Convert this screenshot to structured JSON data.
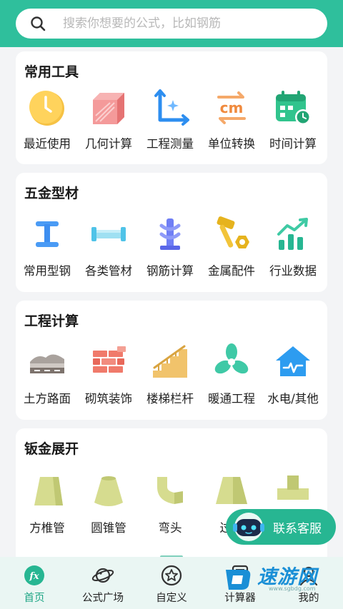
{
  "search": {
    "placeholder": "搜索你想要的公式，比如钢筋"
  },
  "sections": [
    {
      "title": "常用工具",
      "items": [
        {
          "label": "最近使用",
          "icon": "clock-icon"
        },
        {
          "label": "几何计算",
          "icon": "cube-icon"
        },
        {
          "label": "工程测量",
          "icon": "axis-icon"
        },
        {
          "label": "单位转换",
          "icon": "cm-convert-icon"
        },
        {
          "label": "时间计算",
          "icon": "calendar-clock-icon"
        }
      ]
    },
    {
      "title": "五金型材",
      "items": [
        {
          "label": "常用型钢",
          "icon": "i-beam-icon"
        },
        {
          "label": "各类管材",
          "icon": "pipe-icon"
        },
        {
          "label": "钢筋计算",
          "icon": "rebar-icon"
        },
        {
          "label": "金属配件",
          "icon": "hammer-nut-icon"
        },
        {
          "label": "行业数据",
          "icon": "trend-chart-icon"
        }
      ]
    },
    {
      "title": "工程计算",
      "items": [
        {
          "label": "土方路面",
          "icon": "earthwork-icon"
        },
        {
          "label": "砌筑装饰",
          "icon": "brick-wall-icon"
        },
        {
          "label": "楼梯栏杆",
          "icon": "stairs-icon"
        },
        {
          "label": "暖通工程",
          "icon": "fan-icon"
        },
        {
          "label": "水电/其他",
          "icon": "house-pulse-icon"
        }
      ]
    },
    {
      "title": "钣金展开",
      "items": [
        {
          "label": "方椎管",
          "icon": "square-frustum-icon"
        },
        {
          "label": "圆锥管",
          "icon": "cone-frustum-icon"
        },
        {
          "label": "弯头",
          "icon": "elbow-icon"
        },
        {
          "label": "过渡",
          "icon": "transition-icon"
        },
        {
          "label": "",
          "icon": "tee-icon"
        }
      ]
    }
  ],
  "fab": {
    "label": "联系客服"
  },
  "tabs": [
    {
      "label": "首页",
      "icon": "fx-icon",
      "active": true
    },
    {
      "label": "公式广场",
      "icon": "planet-icon",
      "active": false
    },
    {
      "label": "自定义",
      "icon": "star-icon",
      "active": false
    },
    {
      "label": "计算器",
      "icon": "calculator-icon",
      "active": false
    },
    {
      "label": "我的",
      "icon": "user-icon",
      "active": false
    }
  ],
  "watermark": {
    "text": "速游网",
    "sub": "www.sgbdg.com"
  },
  "colors": {
    "brand": "#2fbf9c",
    "active": "#1ea585",
    "watermark": "#1a8fd6"
  }
}
